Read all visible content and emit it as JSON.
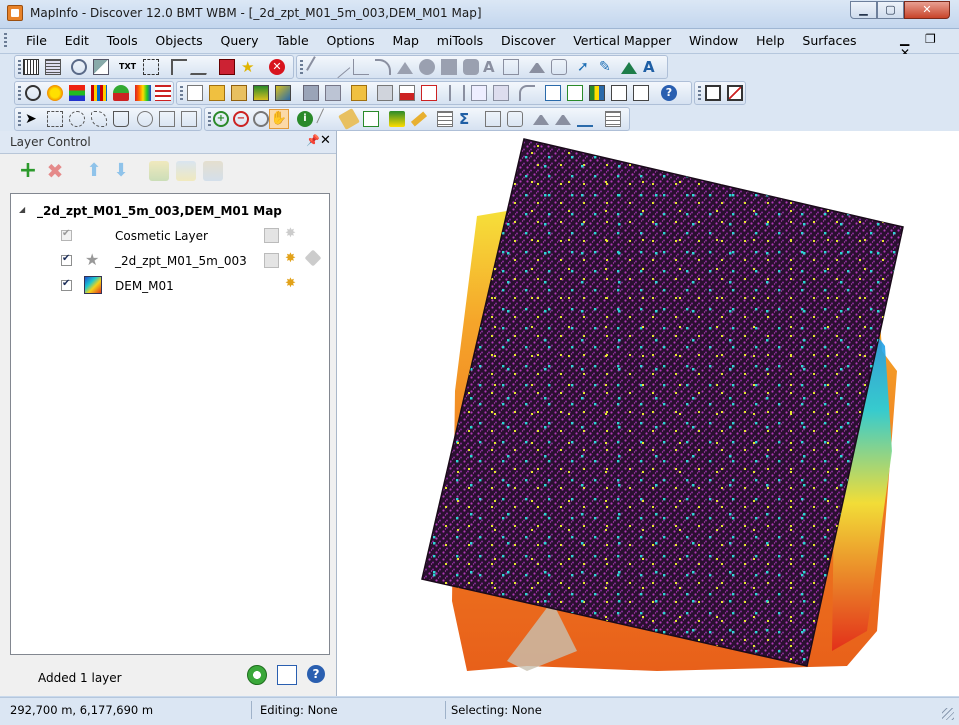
{
  "window": {
    "title": "MapInfo - Discover 12.0   BMT WBM - [_2d_zpt_M01_5m_003,DEM_M01 Map]",
    "controls": {
      "minimize": "▁",
      "maximize": "▢",
      "close": "✕"
    }
  },
  "menubar": {
    "items": [
      "File",
      "Edit",
      "Tools",
      "Objects",
      "Query",
      "Table",
      "Options",
      "Map",
      "miTools",
      "Discover",
      "Vertical Mapper",
      "Window",
      "Help",
      "Surfaces"
    ],
    "mdi_controls": "▁ ❐ ✕"
  },
  "layer_control": {
    "title": "Layer Control",
    "pin_glyph": "📌",
    "close_glyph": "✕",
    "map_node": "_2d_zpt_M01_5m_003,DEM_M01 Map",
    "expand_glyph": "◢",
    "layers": [
      {
        "name": "Cosmetic Layer",
        "checked": true,
        "disabled": true,
        "icon": "none"
      },
      {
        "name": "_2d_zpt_M01_5m_003",
        "checked": true,
        "disabled": false,
        "icon": "star-icon"
      },
      {
        "name": "DEM_M01",
        "checked": true,
        "disabled": false,
        "icon": "grid-icon"
      }
    ],
    "status": "Added 1 layer"
  },
  "statusbar": {
    "coords": "292,700 m, 6,177,690 m",
    "editing": "Editing: None",
    "selecting": "Selecting: None"
  },
  "colors": {
    "points_magenta": "#c040c0",
    "points_cyan": "#2fd6d6",
    "points_yellow": "#e6e630",
    "grid_dark": "#2a1030"
  }
}
